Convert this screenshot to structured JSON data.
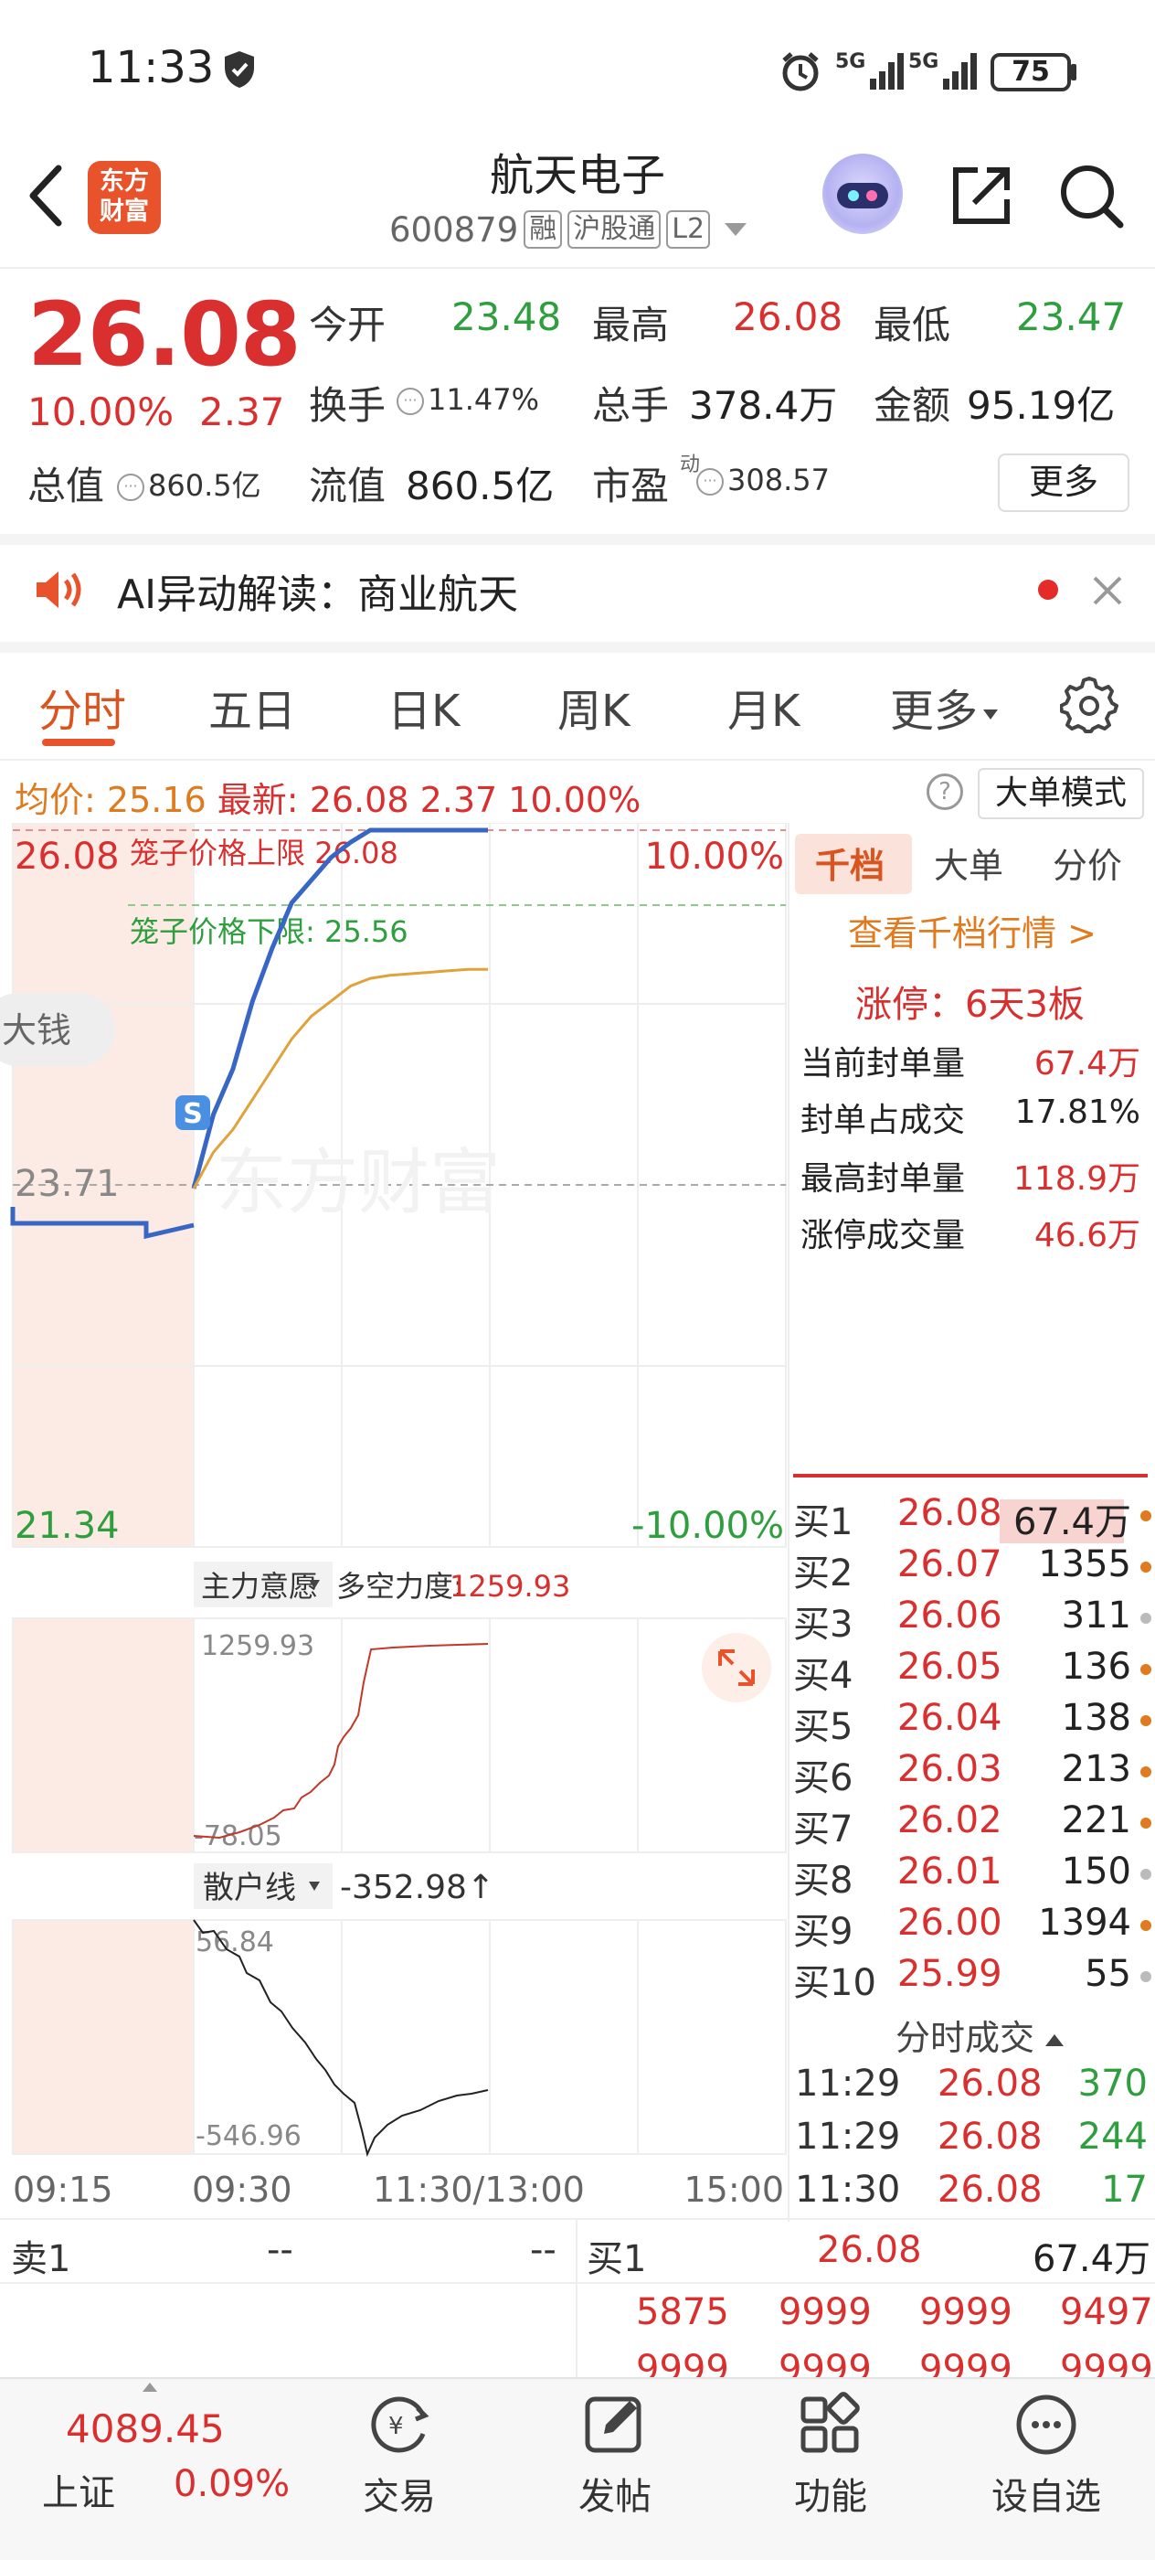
{
  "status": {
    "time": "11:33",
    "battery": "75",
    "net1": "5G",
    "net2": "5G"
  },
  "header": {
    "logo_line1": "东方",
    "logo_line2": "财富",
    "name": "航天电子",
    "code": "600879",
    "tags": [
      "融",
      "沪股通",
      "L2"
    ]
  },
  "quote": {
    "price": "26.08",
    "pct": "10.00%",
    "chg": "2.37",
    "open_label": "今开",
    "open": "23.48",
    "high_label": "最高",
    "high": "26.08",
    "low_label": "最低",
    "low": "23.47",
    "turnover_label": "换手",
    "turnover": "11.47%",
    "volume_label": "总手",
    "volume": "378.4万",
    "amount_label": "金额",
    "amount": "95.19亿",
    "mcap_label": "总值",
    "mcap": "860.5亿",
    "float_label": "流值",
    "float": "860.5亿",
    "pe_label": "市盈",
    "pe_sup": "动",
    "pe": "308.57",
    "more": "更多"
  },
  "ai": {
    "text": "AI异动解读：商业航天"
  },
  "tabs": [
    "分时",
    "五日",
    "日K",
    "周K",
    "月K",
    "更多"
  ],
  "infoline": {
    "avg_label": "均价:",
    "avg": "25.16",
    "latest_label": "最新:",
    "latest": "26.08",
    "chg": "2.37",
    "pct": "10.00%",
    "help": "?",
    "mode_btn": "大单模式"
  },
  "chart": {
    "top_price": "26.08",
    "top_pct": "10.00%",
    "mid_price": "23.71",
    "bottom_price": "21.34",
    "bottom_pct": "-10.00%",
    "upper_cap": "笼子价格上限",
    "upper_cap_val": "26.08",
    "lower_cap": "笼子价格下限",
    "lower_cap_val": "25.56",
    "bigmoney": "大钱",
    "watermark": "东方财富",
    "s_marker": "S",
    "ind1_name": "主力意愿",
    "ind1_label": "多空力度:",
    "ind1_val": "1259.93",
    "ind1_max": "1259.93",
    "ind1_min": "-78.05",
    "ind2_name": "散户线",
    "ind2_val": "-352.98↑",
    "ind2_max": "56.84",
    "ind2_min": "-546.96",
    "times": [
      "09:15",
      "09:30",
      "11:30/13:00",
      "15:00"
    ]
  },
  "chart_data": {
    "type": "line",
    "x": [
      "09:30",
      "09:35",
      "09:40",
      "09:45",
      "09:50",
      "09:55",
      "10:00",
      "10:10",
      "10:20",
      "10:30",
      "10:40",
      "10:50",
      "11:00",
      "11:10",
      "11:20",
      "11:30"
    ],
    "series": [
      {
        "values": [
          23.71,
          24.2,
          24.5,
          24.95,
          25.3,
          25.6,
          25.75,
          25.9,
          26.0,
          26.08,
          26.08,
          26.08,
          26.08,
          26.08,
          26.08,
          26.08
        ]
      },
      {
        "values": [
          23.71,
          23.95,
          24.1,
          24.3,
          24.5,
          24.7,
          24.85,
          24.95,
          25.05,
          25.1,
          25.12,
          25.13,
          25.14,
          25.15,
          25.16,
          25.16
        ]
      }
    ],
    "ylim": [
      21.34,
      26.08
    ]
  },
  "panel": {
    "tabs": [
      "千档",
      "大单",
      "分价"
    ],
    "link": "查看千档行情 >",
    "limit": "涨停：6天3板",
    "rows": [
      {
        "k": "当前封单量",
        "v": "67.4万"
      },
      {
        "k": "封单占成交",
        "v": "17.81%"
      },
      {
        "k": "最高封单量",
        "v": "118.9万"
      },
      {
        "k": "涨停成交量",
        "v": "46.6万"
      }
    ],
    "book": [
      {
        "lbl": "买1",
        "p": "26.08",
        "v": "67.4万",
        "c": "#e07a1f"
      },
      {
        "lbl": "买2",
        "p": "26.07",
        "v": "1355",
        "c": "#e07a1f"
      },
      {
        "lbl": "买3",
        "p": "26.06",
        "v": "311",
        "c": "#bbbbbb"
      },
      {
        "lbl": "买4",
        "p": "26.05",
        "v": "136",
        "c": "#e07a1f"
      },
      {
        "lbl": "买5",
        "p": "26.04",
        "v": "138",
        "c": "#e07a1f"
      },
      {
        "lbl": "买6",
        "p": "26.03",
        "v": "213",
        "c": "#e07a1f"
      },
      {
        "lbl": "买7",
        "p": "26.02",
        "v": "221",
        "c": "#e07a1f"
      },
      {
        "lbl": "买8",
        "p": "26.01",
        "v": "150",
        "c": "#bbbbbb"
      },
      {
        "lbl": "买9",
        "p": "26.00",
        "v": "1394",
        "c": "#e07a1f"
      },
      {
        "lbl": "买10",
        "p": "25.99",
        "v": "55",
        "c": "#bbbbbb"
      }
    ],
    "trades_head": "分时成交",
    "trades": [
      {
        "t": "11:29",
        "p": "26.08",
        "v": "370"
      },
      {
        "t": "11:29",
        "p": "26.08",
        "v": "244"
      },
      {
        "t": "11:30",
        "p": "26.08",
        "v": "17"
      }
    ]
  },
  "orders": {
    "sell_label": "卖1",
    "sell_p": "--",
    "sell_v": "--",
    "buy_label": "买1",
    "buy_p": "26.08",
    "buy_v": "67.4万",
    "queue": [
      "5875",
      "9999",
      "9999",
      "9497"
    ],
    "queue2": [
      "9999",
      "9999",
      "9999",
      "9999"
    ]
  },
  "nav": {
    "index_val": "4089.45",
    "index_name": "上证",
    "index_pct": "0.09%",
    "items": [
      "交易",
      "发帖",
      "功能",
      "设自选"
    ]
  }
}
